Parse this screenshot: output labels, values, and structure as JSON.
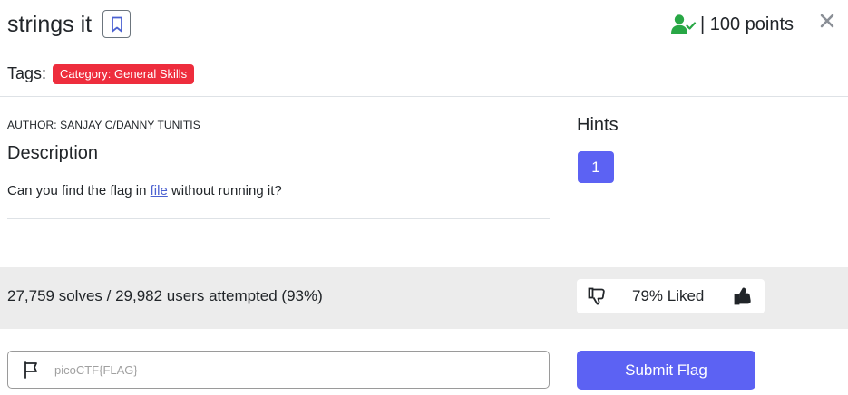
{
  "challenge": {
    "title": "strings it",
    "points_text": "| 100 points",
    "tags_label": "Tags:",
    "tag": "Category: General Skills",
    "author": "AUTHOR: SANJAY C/DANNY TUNITIS",
    "description_heading": "Description",
    "description_before": "Can you find the flag in ",
    "description_link": "file",
    "description_after": " without running it?"
  },
  "hints": {
    "heading": "Hints",
    "items": [
      "1"
    ]
  },
  "stats": {
    "solves_text": "27,759 solves / 29,982 users attempted (93%)",
    "liked_text": "79% Liked"
  },
  "flag": {
    "placeholder": "picoCTF{FLAG}",
    "value": "",
    "submit_label": "Submit Flag"
  },
  "icons": {
    "bookmark": "bookmark-icon",
    "solved": "user-check-icon",
    "close": "close-icon",
    "thumbs_down": "thumbs-down-icon",
    "thumbs_up": "thumbs-up-icon",
    "flag": "flag-icon"
  },
  "colors": {
    "accent": "#5c62f3",
    "tag": "#ee2d3d",
    "solved": "#28a745",
    "link": "#4b61d1",
    "stats_band": "#ececec"
  }
}
